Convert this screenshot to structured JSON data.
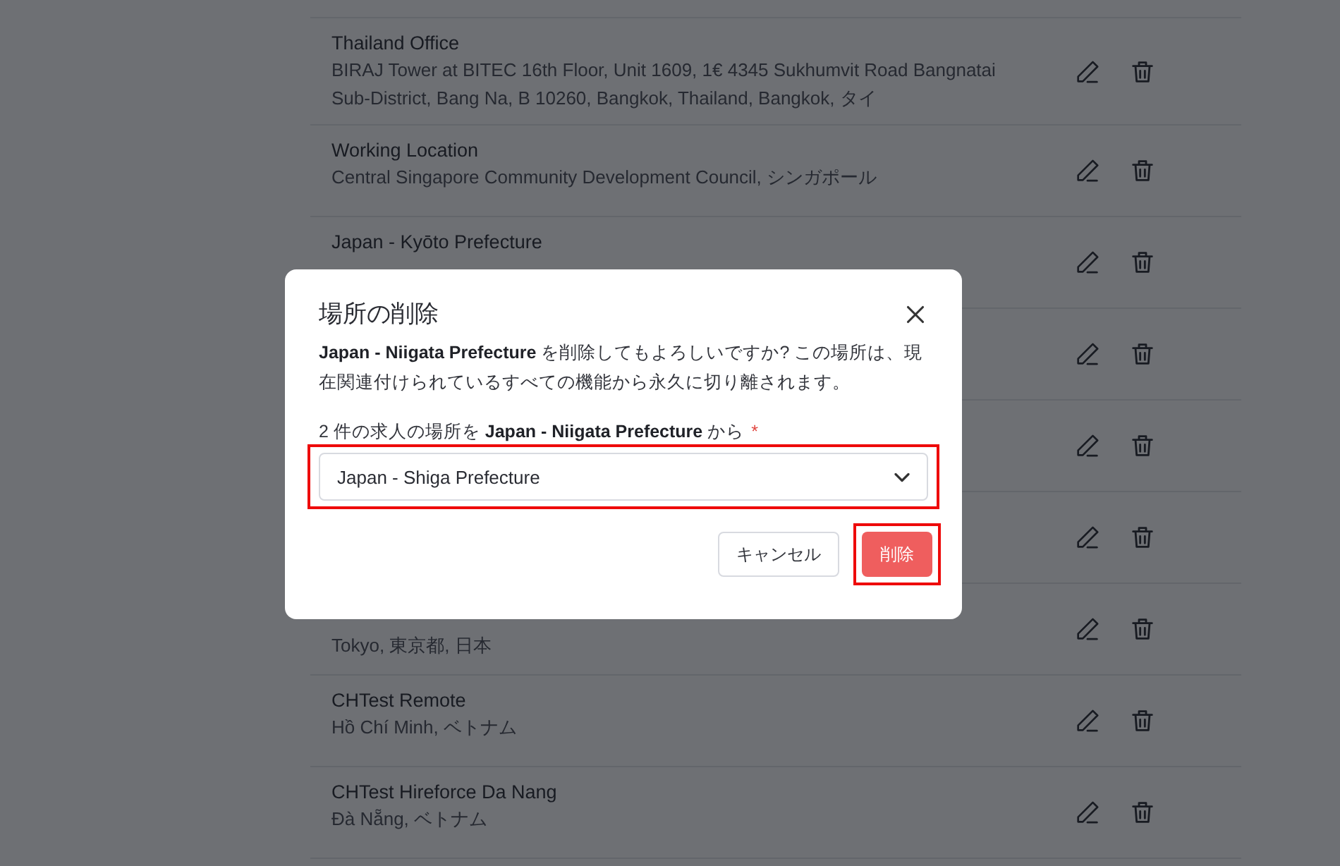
{
  "locations": [
    {
      "kind": "location",
      "name": "Thailand Office",
      "address": "BIRAJ Tower at BITEC 16th Floor, Unit 1609, 1€ 4345 Sukhumvit Road Bangnatai Sub-District, Bang Na, B 10260, Bangkok, Thailand, Bangkok, タイ"
    },
    {
      "kind": "location",
      "name": "Working Location",
      "address": "Central Singapore Community Development Council, シンガポール"
    },
    {
      "kind": "location",
      "name": "Japan - Kyōto Prefecture"
    },
    {
      "kind": "location"
    },
    {
      "kind": "location"
    },
    {
      "kind": "location"
    },
    {
      "kind": "location",
      "address": "Tokyo, 東京都, 日本"
    },
    {
      "kind": "location",
      "name": "CHTest Remote",
      "address": "Hồ Chí Minh, ベトナム"
    },
    {
      "kind": "location",
      "name": "CHTest Hireforce Da Nang",
      "address": "Đà Nẵng, ベトナム"
    }
  ],
  "dialog": {
    "title": "場所の削除",
    "message": "**Japan - Niigata Prefecture** を削除してもよろしいですか? この場所は、現在関連付けられているすべての機能から永久に切り離されます。",
    "field_label": "2 件の求人の場所を **Japan - Niigata Prefecture** から",
    "required_mark": "*",
    "select": {
      "value": "Japan - Shiga Prefecture",
      "highlighted": true
    },
    "buttons": [
      {
        "label": "キャンセル",
        "kind": "secondary"
      },
      {
        "label": "削除",
        "kind": "danger",
        "highlighted": true
      }
    ]
  }
}
